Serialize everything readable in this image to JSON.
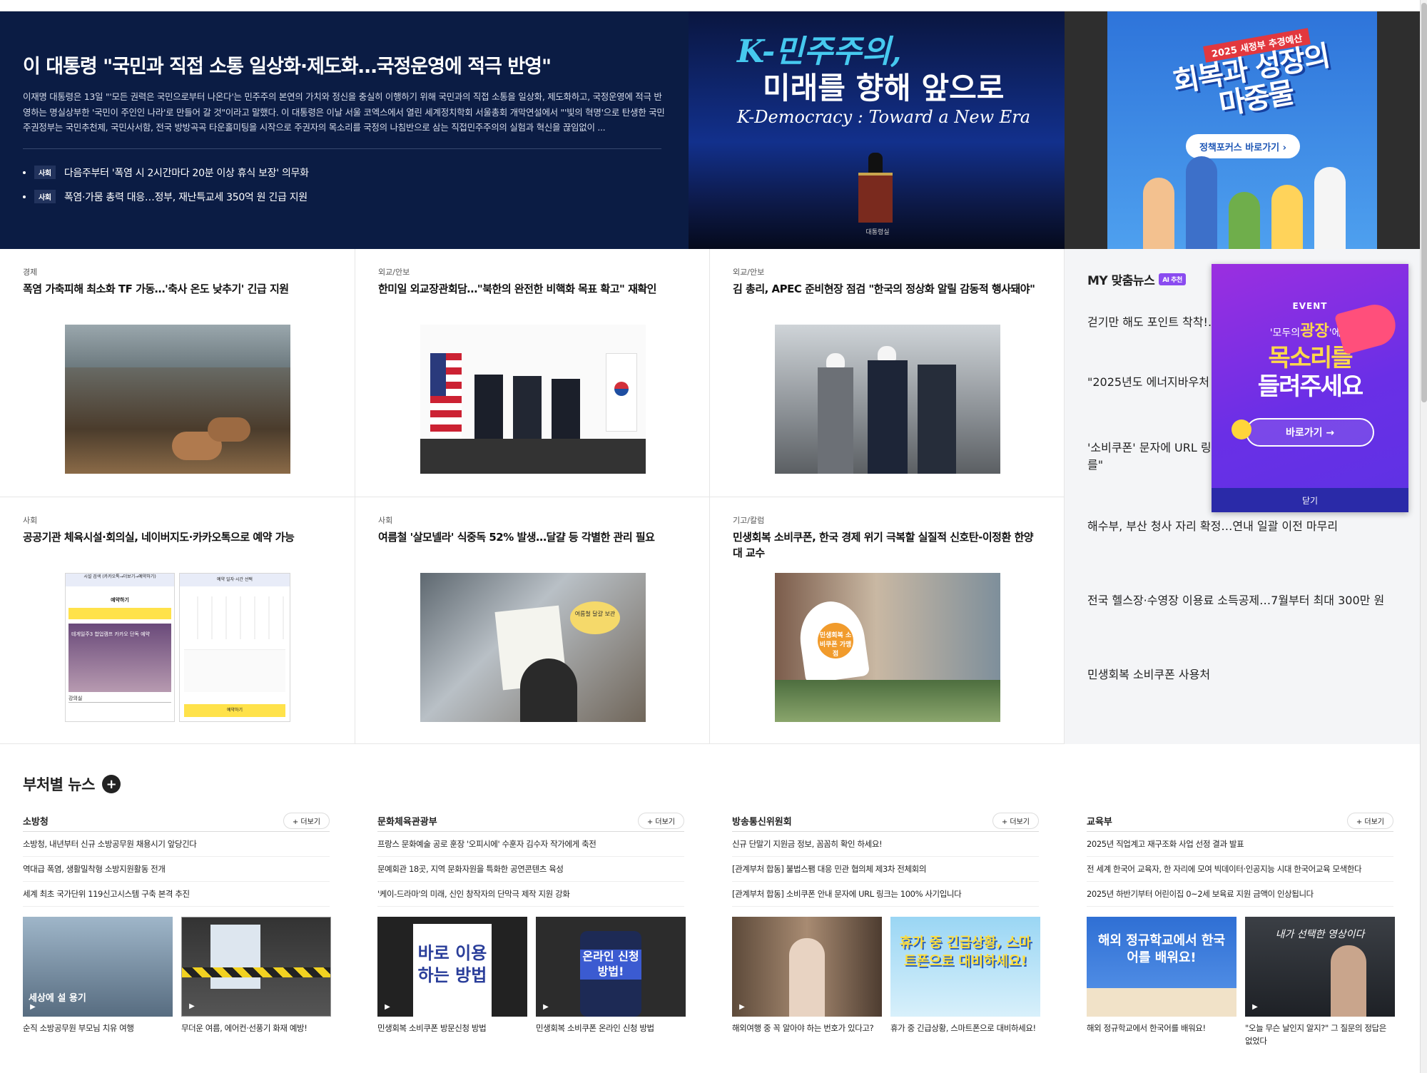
{
  "hero": {
    "title": "이 대통령 \"국민과 직접 소통 일상화·제도화…국정운영에 적극 반영\"",
    "lead": "이재명 대통령은 13일 \"'모든 권력은 국민으로부터 나온다'는 민주주의 본연의 가치와 정신을 충실히 이행하기 위해 국민과의 직접 소통을 일상화, 제도화하고, 국정운영에 적극 반영하는 명실상부한 '국민이 주인인 나라'로 만들어 갈 것\"이라고 말했다. 이 대통령은 이날 서울 코엑스에서 열린 세계정치학회 서울총회 개막연설에서 \"'빛의 혁명'으로 탄생한 국민주권정부는 국민추천제, 국민사서함, 전국 방방곡곡 타운홀미팅을 시작으로 주권자의 목소리를 국정의 나침반으로 삼는 직접민주주의의 실험과 혁신을 끊임없이 ...",
    "links": [
      {
        "tag": "사회",
        "text": "다음주부터 '폭염 시 2시간마다 20분 이상 휴식 보장' 의무화"
      },
      {
        "tag": "사회",
        "text": "폭염·가뭄 총력 대응…정부, 재난특교세 350억 원 긴급 지원"
      }
    ]
  },
  "banner1": {
    "line1": "K-민주주의,",
    "line2": "미래를 향해 앞으로",
    "line3": "K-Democracy : Toward a New Era",
    "seal": "대통령실"
  },
  "banner2": {
    "year": "2025 새정부 추경예산",
    "big": "회복과 성장의 마중물",
    "button": "정책포커스 바로가기 ›"
  },
  "articles": [
    {
      "cat": "경제",
      "title": "폭염 가축피해 최소화 TF 가동…'축사 온도 낮추기' 긴급 지원"
    },
    {
      "cat": "외교/안보",
      "title": "한미일 외교장관회담…\"북한의 완전한 비핵화 목표 확고\" 재확인"
    },
    {
      "cat": "외교/안보",
      "title": "김 총리, APEC 준비현장 점검 \"한국의 정상화 알릴 감동적 행사돼야\""
    },
    {
      "cat": "사회",
      "title": "공공기관 체육시설·회의실, 네이버지도·카카오톡으로 예약 가능"
    },
    {
      "cat": "사회",
      "title": "여름철 '살모넬라' 식중독 52% 발생…달걀 등 각별한 관리 필요"
    },
    {
      "cat": "기고/칼럼",
      "title": "민생회복 소비쿠폰, 한국 경제 위기 극복할 실질적 신호탄-이정환 한양대 교수"
    }
  ],
  "thumbtext": {
    "app_tab1": "시설 검색 (카카오톡→더보기→예약하기)",
    "app_tab2": "예약 일자·시간 선택",
    "app_title": "예약하기",
    "app_banner": "테게일주3 합업캠프 카카오 단독 예약",
    "app_search": "강의실",
    "app_btn": "예약하기",
    "sign1": "여름철 달걀 보관",
    "coupon_sign": "민생회복 소비쿠폰 가맹점"
  },
  "mynews": {
    "title": "MY 맞춤뉴스",
    "ai_badge": "AI 추천",
    "items": [
      "걷기만 해도 포인트 착착!…건강",
      "\"2025년도 에너지바우처 6월 9",
      "'소비쿠폰' 문자에 URL 링크있다\n를\"",
      "해수부, 부산 청사 자리 확정…연내 일괄 이전 마무리",
      "전국 헬스장·수영장 이용료 소득공제…7월부터 최대 300만 원",
      "민생회복 소비쿠폰 사용처"
    ]
  },
  "popup": {
    "event": "EVENT",
    "sub_pre": "'모두의",
    "sub_bold": "광장",
    "sub_post": "'에서",
    "line1": "목소리를",
    "line2": "들려주세요",
    "go": "바로가기 →",
    "close": "닫기"
  },
  "dept_section": {
    "title": "부처별 뉴스",
    "more": "+ 더보기"
  },
  "depts": [
    {
      "name": "소방청",
      "news": [
        "소방청, 내년부터 신규 소방공무원 채용시기 앞당긴다",
        "역대급 폭염, 생활밀착형 소방지원활동 전개",
        "세계 최초 국가단위 119신고시스템 구축 본격 추진"
      ],
      "videos": [
        {
          "caption": "순직 소방공무원 부모님 치유 여행",
          "overlay": "세상에 설 용기"
        },
        {
          "caption": "무더운 여름, 에어컨·선풍기 화재 예방!",
          "overlay": ""
        }
      ]
    },
    {
      "name": "문화체육관광부",
      "news": [
        "프랑스 문화예술 공로 훈장 '오피시에' 수훈자 김수자 작가에게 축전",
        "문예회관 18곳, 지역 문화자원을 특화한 공연콘텐츠 육성",
        "'케이-드라마'의 미래, 신인 창작자의 단막극 제작 지원 강화"
      ],
      "videos": [
        {
          "caption": "민생회복 소비쿠폰 방문신청 방법",
          "overlay": "바로 이용하는 방법"
        },
        {
          "caption": "민생회복 소비쿠폰 온라인 신청 방법",
          "overlay": "온라인 신청 방법!"
        }
      ]
    },
    {
      "name": "방송통신위원회",
      "news": [
        "신규 단말기 지원금 정보, 꼼꼼히 확인 하세요!",
        "[관계부처 합동] 불법스팸 대응 민관 협의체 제3차 전체회의",
        "[관계부처 합동] 소비쿠폰 안내 문자에 URL 링크는 100% 사기입니다"
      ],
      "videos": [
        {
          "caption": "해외여행 중 꼭 알아야 하는 번호가 있다고?",
          "overlay": ""
        },
        {
          "caption": "휴가 중 긴급상황, 스마트폰으로 대비하세요!",
          "overlay": "휴가 중 긴급상황, 스마트폰으로 대비하세요!"
        }
      ]
    },
    {
      "name": "교육부",
      "news": [
        "2025년 직업계고 재구조화 사업 선정 결과 발표",
        "전 세계 한국어 교육자, 한 자리에 모여 빅데이터·인공지능 시대 한국어교육 모색한다",
        "2025년 하반기부터 어린이집 0~2세 보육료 지원 금액이 인상됩니다"
      ],
      "videos": [
        {
          "caption": "해외 정규학교에서 한국어를 배워요!",
          "overlay": "해외 정규학교에서 한국어를 배워요!"
        },
        {
          "caption": "\"오늘 무슨 날인지 알지?\" 그 질문의 정답은 없었다",
          "overlay": "내가 선택한 영상이다"
        }
      ]
    }
  ]
}
